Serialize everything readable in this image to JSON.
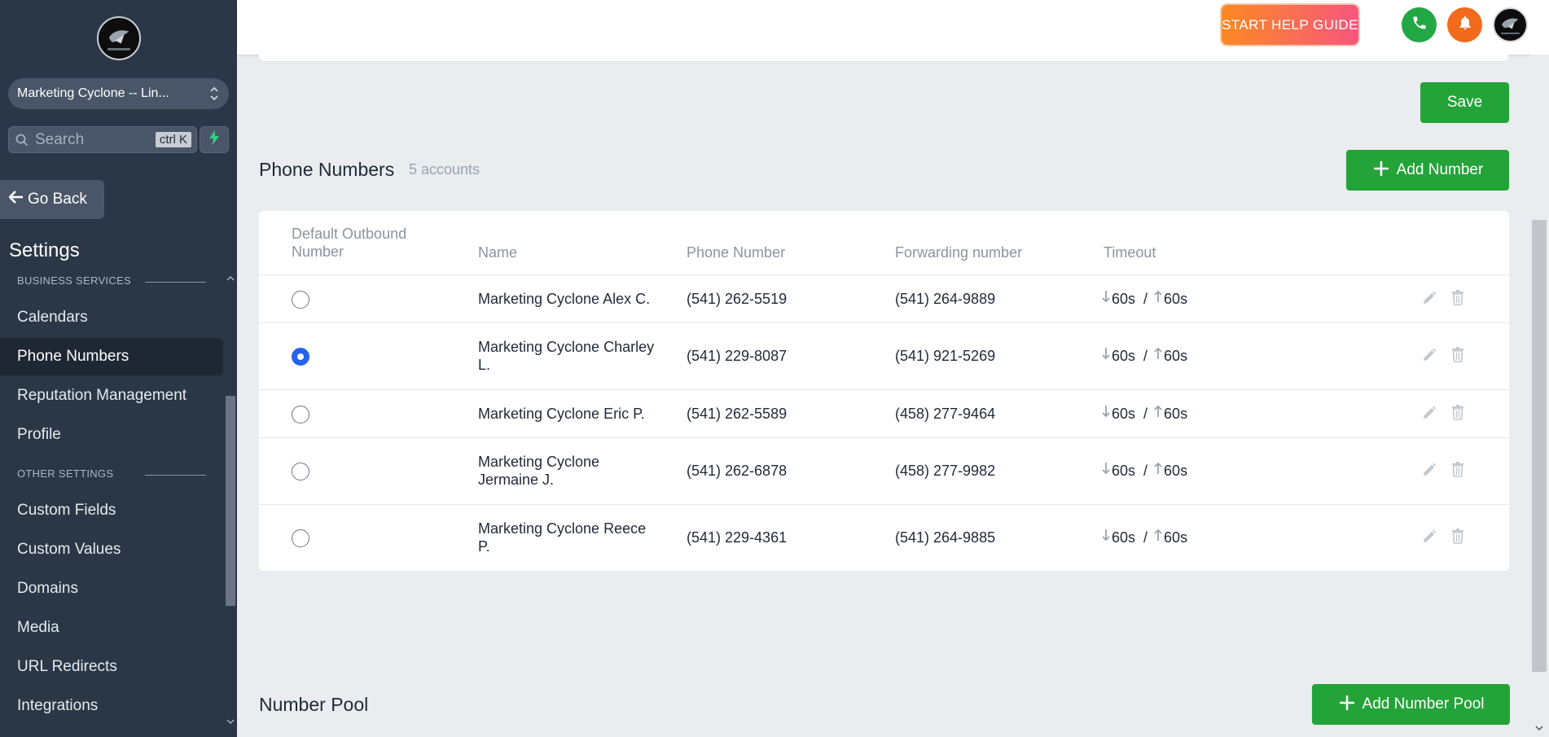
{
  "sidebar": {
    "account_name": "Marketing Cyclone -- Lin...",
    "search_placeholder": "Search",
    "search_shortcut": "ctrl K",
    "go_back_label": "Go Back",
    "settings_title": "Settings",
    "sections": [
      {
        "label": "BUSINESS SERVICES"
      },
      {
        "label": "OTHER SETTINGS"
      }
    ],
    "items": [
      {
        "label": "Calendars"
      },
      {
        "label": "Phone Numbers",
        "active": true
      },
      {
        "label": "Reputation Management"
      },
      {
        "label": "Profile"
      },
      {
        "label": "Custom Fields"
      },
      {
        "label": "Custom Values"
      },
      {
        "label": "Domains"
      },
      {
        "label": "Media"
      },
      {
        "label": "URL Redirects"
      },
      {
        "label": "Integrations"
      }
    ]
  },
  "topbar": {
    "help_label": "START HELP GUIDE"
  },
  "main": {
    "save_label": "Save",
    "phone_numbers_title": "Phone Numbers",
    "phone_numbers_count": "5 accounts",
    "add_number_label": "Add Number",
    "number_pool_title": "Number Pool",
    "add_pool_label": "Add Number Pool"
  },
  "table": {
    "headers": {
      "default_outbound": "Default Outbound Number",
      "name": "Name",
      "phone": "Phone Number",
      "forwarding": "Forwarding number",
      "timeout": "Timeout"
    },
    "rows": [
      {
        "default": false,
        "name": "Marketing Cyclone Alex C.",
        "phone": "(541) 262-5519",
        "forwarding": "(541) 264-9889",
        "timeout_down": "60s",
        "timeout_up": "60s"
      },
      {
        "default": true,
        "name": "Marketing Cyclone Charley L.",
        "phone": "(541) 229-8087",
        "forwarding": "(541) 921-5269",
        "timeout_down": "60s",
        "timeout_up": "60s"
      },
      {
        "default": false,
        "name": "Marketing Cyclone Eric P.",
        "phone": "(541) 262-5589",
        "forwarding": "(458) 277-9464",
        "timeout_down": "60s",
        "timeout_up": "60s"
      },
      {
        "default": false,
        "name": "Marketing Cyclone Jermaine J.",
        "phone": "(541) 262-6878",
        "forwarding": "(458) 277-9982",
        "timeout_down": "60s",
        "timeout_up": "60s"
      },
      {
        "default": false,
        "name": "Marketing Cyclone Reece P.",
        "phone": "(541) 229-4361",
        "forwarding": "(541) 264-9885",
        "timeout_down": "60s",
        "timeout_up": "60s"
      }
    ]
  },
  "colors": {
    "sidebar_bg": "#2b3746",
    "accent_green": "#24a339",
    "radio_selected": "#2563eb",
    "help_gradient_start": "#fb8a23",
    "help_gradient_end": "#f7567e"
  },
  "icons": {
    "search": "search-icon",
    "bolt": "bolt-icon",
    "back": "arrow-left-icon",
    "phone": "phone-icon",
    "bell": "bell-icon",
    "edit": "pencil-icon",
    "delete": "trash-icon",
    "timeout_down": "arrow-down-icon",
    "timeout_up": "arrow-up-icon"
  }
}
